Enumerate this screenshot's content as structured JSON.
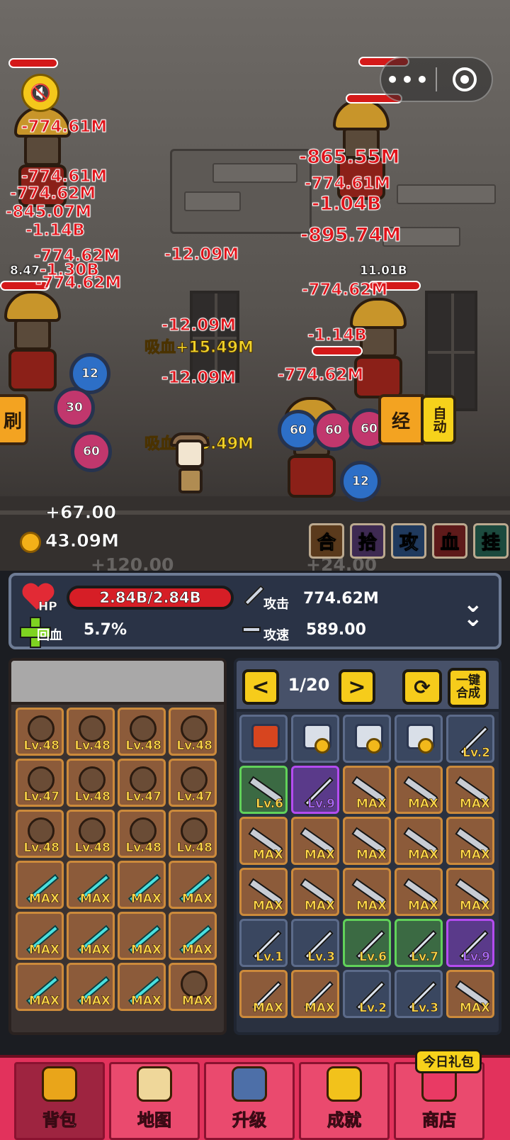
{
  "scene": {
    "damage_numbers": [
      "-774.61M",
      "-774.61M",
      "-774.62M",
      "-845.07M",
      "-1.14B",
      "-774.62M",
      "-1.30B",
      "-774.62M",
      "-12.09M",
      "-865.55M",
      "-774.61M",
      "-1.04B",
      "-895.74M",
      "-774.62M",
      "-1.14B",
      "-774.62M",
      "-12.09M",
      "-12.09M"
    ],
    "heal_texts": [
      "吸血+15.49M",
      "吸血+15.49M"
    ],
    "enemy_labels": [
      "8.47",
      "11.01B"
    ],
    "coin_values": [
      "12",
      "30",
      "60",
      "60",
      "60",
      "60",
      "12"
    ],
    "left_button": "刷",
    "right_button": "经",
    "auto_button": "自动",
    "mute_icon": "speaker-muted-icon",
    "gain_text": "+67.00",
    "gold": "43.09M",
    "ghost_texts": [
      "+120.00",
      "+24.00"
    ],
    "skills": [
      {
        "label": "合",
        "color": "#f0c24a"
      },
      {
        "label": "拾",
        "color": "#c57df0"
      },
      {
        "label": "攻",
        "color": "#6fb4ff"
      },
      {
        "label": "血",
        "color": "#ff3a3a"
      },
      {
        "label": "挂",
        "color": "#5fe0b5"
      }
    ]
  },
  "capsule": {
    "more_icon": "more-dots-icon",
    "record_icon": "target-circle-icon"
  },
  "stats": {
    "hp_tag": "HP",
    "hp_value": "2.84B/2.84B",
    "regen_label": "回血",
    "regen_value": "5.7%",
    "attack_label": "攻击",
    "attack_value": "774.62M",
    "speed_label": "攻速",
    "speed_value": "589.00",
    "expand_icon": "double-chevron-down-icon"
  },
  "equipment": {
    "slots": [
      {
        "lv": "Lv.48",
        "icon": "necklace-icon"
      },
      {
        "lv": "Lv.48",
        "icon": "helmet-icon"
      },
      {
        "lv": "Lv.48",
        "icon": "shield-icon"
      },
      {
        "lv": "Lv.48",
        "icon": "gem-icon"
      },
      {
        "lv": "Lv.47",
        "icon": "glove-icon"
      },
      {
        "lv": "Lv.48",
        "icon": "armor-icon"
      },
      {
        "lv": "Lv.47",
        "icon": "glove-icon"
      },
      {
        "lv": "Lv.47",
        "icon": "wreath-icon"
      },
      {
        "lv": "Lv.48",
        "icon": "boots-icon"
      },
      {
        "lv": "Lv.48",
        "icon": "pants-icon"
      },
      {
        "lv": "Lv.48",
        "icon": "jade-icon"
      },
      {
        "lv": "Lv.48",
        "icon": "ring-icon"
      },
      {
        "lv": "MAX",
        "icon": "sword-icon"
      },
      {
        "lv": "MAX",
        "icon": "sword-icon"
      },
      {
        "lv": "MAX",
        "icon": "sword-icon"
      },
      {
        "lv": "MAX",
        "icon": "sword-icon"
      },
      {
        "lv": "MAX",
        "icon": "sword-icon"
      },
      {
        "lv": "MAX",
        "icon": "sword-icon"
      },
      {
        "lv": "MAX",
        "icon": "sword-icon"
      },
      {
        "lv": "MAX",
        "icon": "sword-icon"
      },
      {
        "lv": "MAX",
        "icon": "sword-icon"
      },
      {
        "lv": "MAX",
        "icon": "sword-icon"
      },
      {
        "lv": "MAX",
        "icon": "sword-icon"
      },
      {
        "lv": "MAX",
        "icon": "scepter-icon"
      }
    ]
  },
  "inventory": {
    "page": "1/20",
    "prev_icon": "chevron-left-icon",
    "next_icon": "chevron-right-icon",
    "refresh_icon": "refresh-icon",
    "merge_all": "一键合成",
    "items": [
      {
        "lv": "",
        "style": "blue",
        "icon": "red-scroll-icon"
      },
      {
        "lv": "",
        "style": "blue",
        "icon": "medal-scroll-icon"
      },
      {
        "lv": "",
        "style": "blue",
        "icon": "medal-scroll-icon"
      },
      {
        "lv": "",
        "style": "blue",
        "icon": "medal-scroll-icon"
      },
      {
        "lv": "Lv.2",
        "style": "blue",
        "icon": "sword-icon"
      },
      {
        "lv": "Lv.6",
        "style": "green",
        "icon": "knife-icon"
      },
      {
        "lv": "Lv.9",
        "style": "purple",
        "icon": "lightning-blade-icon"
      },
      {
        "lv": "MAX",
        "style": "orange",
        "icon": "knife-icon"
      },
      {
        "lv": "MAX",
        "style": "orange",
        "icon": "knife-icon"
      },
      {
        "lv": "MAX",
        "style": "orange",
        "icon": "knife-icon"
      },
      {
        "lv": "MAX",
        "style": "orange",
        "icon": "knife-icon"
      },
      {
        "lv": "MAX",
        "style": "orange",
        "icon": "knife-icon"
      },
      {
        "lv": "MAX",
        "style": "orange",
        "icon": "knife-icon"
      },
      {
        "lv": "MAX",
        "style": "orange",
        "icon": "knife-icon"
      },
      {
        "lv": "MAX",
        "style": "orange",
        "icon": "knife-icon"
      },
      {
        "lv": "MAX",
        "style": "orange",
        "icon": "knife-icon"
      },
      {
        "lv": "MAX",
        "style": "orange",
        "icon": "knife-icon"
      },
      {
        "lv": "MAX",
        "style": "orange",
        "icon": "knife-icon"
      },
      {
        "lv": "MAX",
        "style": "orange",
        "icon": "knife-icon"
      },
      {
        "lv": "MAX",
        "style": "orange",
        "icon": "knife-icon"
      },
      {
        "lv": "Lv.1",
        "style": "blue",
        "icon": "sword-icon"
      },
      {
        "lv": "Lv.3",
        "style": "blue",
        "icon": "sword-icon"
      },
      {
        "lv": "Lv.6",
        "style": "green",
        "icon": "sword-icon"
      },
      {
        "lv": "Lv.7",
        "style": "green",
        "icon": "sword-icon"
      },
      {
        "lv": "Lv.9",
        "style": "purple",
        "icon": "sword-icon"
      },
      {
        "lv": "MAX",
        "style": "orange",
        "icon": "sword-icon"
      },
      {
        "lv": "MAX",
        "style": "orange",
        "icon": "sword-icon"
      },
      {
        "lv": "Lv.2",
        "style": "blue",
        "icon": "sword-icon"
      },
      {
        "lv": "Lv.3",
        "style": "blue",
        "icon": "sword-icon"
      },
      {
        "lv": "MAX",
        "style": "orange",
        "icon": "knife-icon"
      }
    ]
  },
  "nav": {
    "gift_badge": "今日礼包",
    "tabs": [
      {
        "label": "背包",
        "icon": "bag-icon",
        "active": true
      },
      {
        "label": "地图",
        "icon": "map-icon",
        "active": false
      },
      {
        "label": "升级",
        "icon": "robot-icon",
        "active": false
      },
      {
        "label": "成就",
        "icon": "trophy-icon",
        "active": false
      },
      {
        "label": "商店",
        "icon": "shop-icon",
        "active": false
      }
    ]
  }
}
